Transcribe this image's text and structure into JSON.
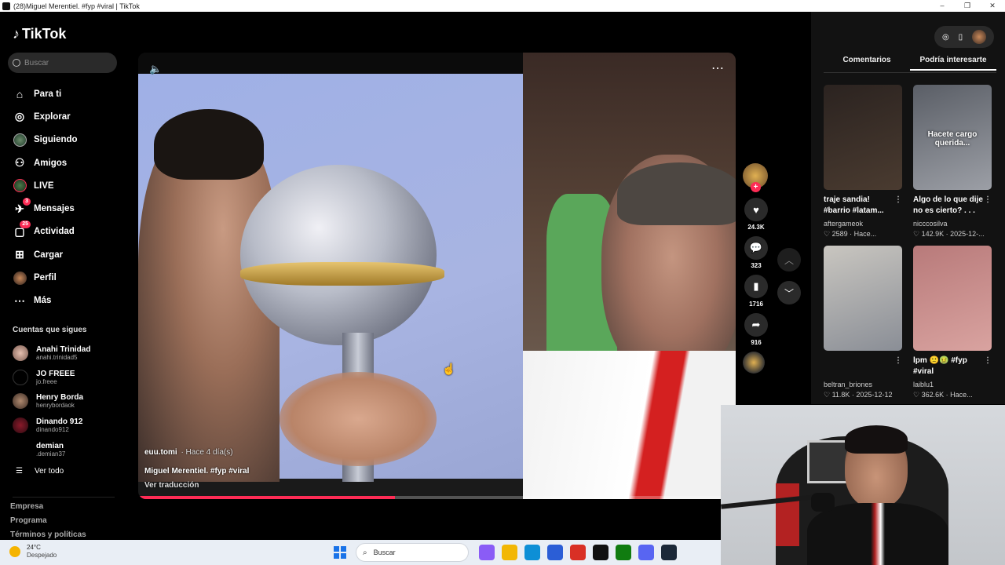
{
  "window": {
    "title": "(28)Miguel Merentiel. #fyp #viral | TikTok",
    "controls": [
      "–",
      "❐",
      "✕"
    ]
  },
  "brand": {
    "name": "TikTok"
  },
  "search": {
    "placeholder": "Buscar"
  },
  "nav": [
    {
      "label": "Para ti",
      "icon": "home-icon",
      "glyph": "⌂"
    },
    {
      "label": "Explorar",
      "icon": "compass-icon",
      "glyph": "◎"
    },
    {
      "label": "Siguiendo",
      "icon": "following-avatar-icon",
      "glyph": ""
    },
    {
      "label": "Amigos",
      "icon": "friends-icon",
      "glyph": "⚇"
    },
    {
      "label": "LIVE",
      "icon": "live-avatar-icon",
      "glyph": ""
    },
    {
      "label": "Mensajes",
      "icon": "messages-icon",
      "glyph": "✈",
      "badge": "3"
    },
    {
      "label": "Actividad",
      "icon": "activity-icon",
      "glyph": "▢",
      "badge": "25"
    },
    {
      "label": "Cargar",
      "icon": "upload-icon",
      "glyph": "⊞"
    },
    {
      "label": "Perfil",
      "icon": "profile-avatar-icon",
      "glyph": ""
    },
    {
      "label": "Más",
      "icon": "more-icon",
      "glyph": "⋯"
    }
  ],
  "following": {
    "title": "Cuentas que sigues",
    "accounts": [
      {
        "name": "Anahi Trinidad",
        "handle": "anahi.trinidad5"
      },
      {
        "name": "JO FREEE",
        "handle": "jo.freee"
      },
      {
        "name": "Henry Borda",
        "handle": "henrybordaok"
      },
      {
        "name": "Dinando 912",
        "handle": "dinando912"
      },
      {
        "name": "demian",
        "handle": ".demian37"
      }
    ],
    "see_all": "Ver todo"
  },
  "footer": [
    "Empresa",
    "Programa",
    "Términos y políticas"
  ],
  "video": {
    "author": "euu.tomi",
    "date": "· Hace 4 día(s)",
    "description": "Miguel Merentiel. #fyp #viral",
    "translate": "Ver traducción",
    "progress": 0.43
  },
  "actions": {
    "likes": "24.3K",
    "comments": "323",
    "saves": "1716",
    "shares": "916"
  },
  "right_panel": {
    "tabs": [
      "Comentarios",
      "Podría interesarte"
    ],
    "active_tab": 1,
    "cards": [
      {
        "title": "traje sandia! #barrio #latam...",
        "author": "aftergameok",
        "stats": "♡ 2589 · Hace...",
        "overlay": "",
        "colors": [
          "#2b2320",
          "#4a3b30"
        ]
      },
      {
        "title": "Algo de lo que dije no es cierto? . . . ...",
        "author": "nicccosilva",
        "stats": "♡ 142.9K · 2025-12-...",
        "overlay": "Hacete cargo querida...",
        "colors": [
          "#5a5e66",
          "#9c9fa6"
        ]
      },
      {
        "title": "",
        "author": "beltran_briones",
        "stats": "♡ 11.8K · 2025-12-12",
        "overlay": "",
        "colors": [
          "#c9c6c0",
          "#8a8e96"
        ]
      },
      {
        "title": "lpm 🙁🤢 #fyp #viral",
        "author": "laiblu1",
        "stats": "♡ 362.6K · Hace...",
        "overlay": "",
        "colors": [
          "#b87a7a",
          "#d9a3a0"
        ]
      }
    ]
  },
  "taskbar": {
    "temp": "24°C",
    "weather": "Despejado",
    "search": "Buscar",
    "apps": [
      {
        "name": "copilot-icon",
        "color": "#8a5cf6"
      },
      {
        "name": "file-explorer-icon",
        "color": "#f2b705"
      },
      {
        "name": "edge-icon",
        "color": "#0d8fd6"
      },
      {
        "name": "store-icon",
        "color": "#2b5ed6"
      },
      {
        "name": "chrome-icon",
        "color": "#d93025"
      },
      {
        "name": "tiktok-app-icon",
        "color": "#111111"
      },
      {
        "name": "xbox-icon",
        "color": "#107c10"
      },
      {
        "name": "discord-icon",
        "color": "#5865f2"
      },
      {
        "name": "steam-icon",
        "color": "#1b2838"
      }
    ]
  }
}
